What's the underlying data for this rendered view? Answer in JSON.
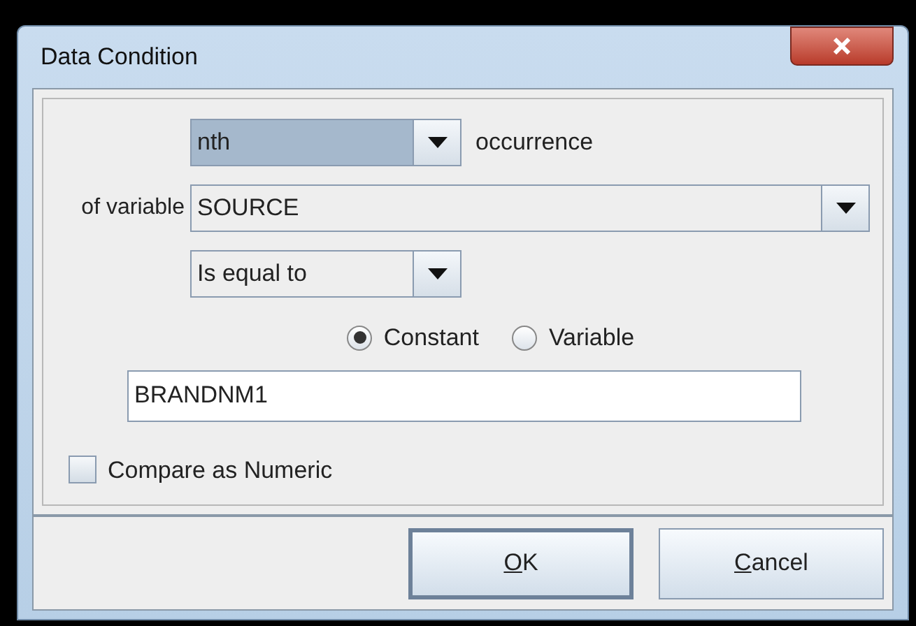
{
  "window": {
    "title": "Data Condition"
  },
  "occurrence_combo": {
    "value": "nth",
    "selected": true
  },
  "occurrence_label": "occurrence",
  "variable_label": "of variable",
  "variable_combo": {
    "value": "SOURCE"
  },
  "operator_combo": {
    "value": "Is equal to"
  },
  "radios": [
    {
      "label": "Constant",
      "selected": true
    },
    {
      "label": "Variable",
      "selected": false
    }
  ],
  "value_field": {
    "value": "BRANDNM1"
  },
  "compare_numeric": {
    "label": "Compare as Numeric",
    "checked": false
  },
  "buttons": [
    {
      "label": "OK"
    },
    {
      "label": "Cancel"
    }
  ]
}
